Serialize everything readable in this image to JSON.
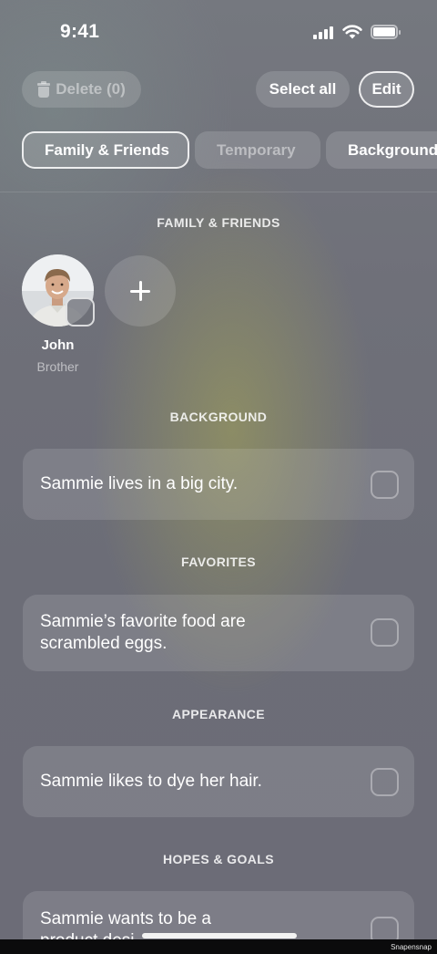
{
  "status_bar": {
    "time": "9:41"
  },
  "toolbar": {
    "delete_label": "Delete (0)",
    "select_all_label": "Select all",
    "edit_label": "Edit"
  },
  "tabs": [
    {
      "label": "Family & Friends",
      "active": true
    },
    {
      "label": "Temporary",
      "active": false
    },
    {
      "label": "Background",
      "active": false
    }
  ],
  "family_section": {
    "title": "FAMILY & FRIENDS",
    "people": [
      {
        "name": "John",
        "relation": "Brother"
      }
    ]
  },
  "sections": [
    {
      "title": "BACKGROUND",
      "text": "Sammie lives in a big city."
    },
    {
      "title": "FAVORITES",
      "text": "Sammie’s favorite food are scrambled eggs."
    },
    {
      "title": "APPEARANCE",
      "text": "Sammie likes to dye her hair."
    },
    {
      "title": "HOPES & GOALS",
      "text": "Sammie wants to be a product desi..."
    }
  ],
  "watermark": "Snapensnap",
  "colors": {
    "background": "#6e6f78",
    "text": "#ffffff"
  }
}
